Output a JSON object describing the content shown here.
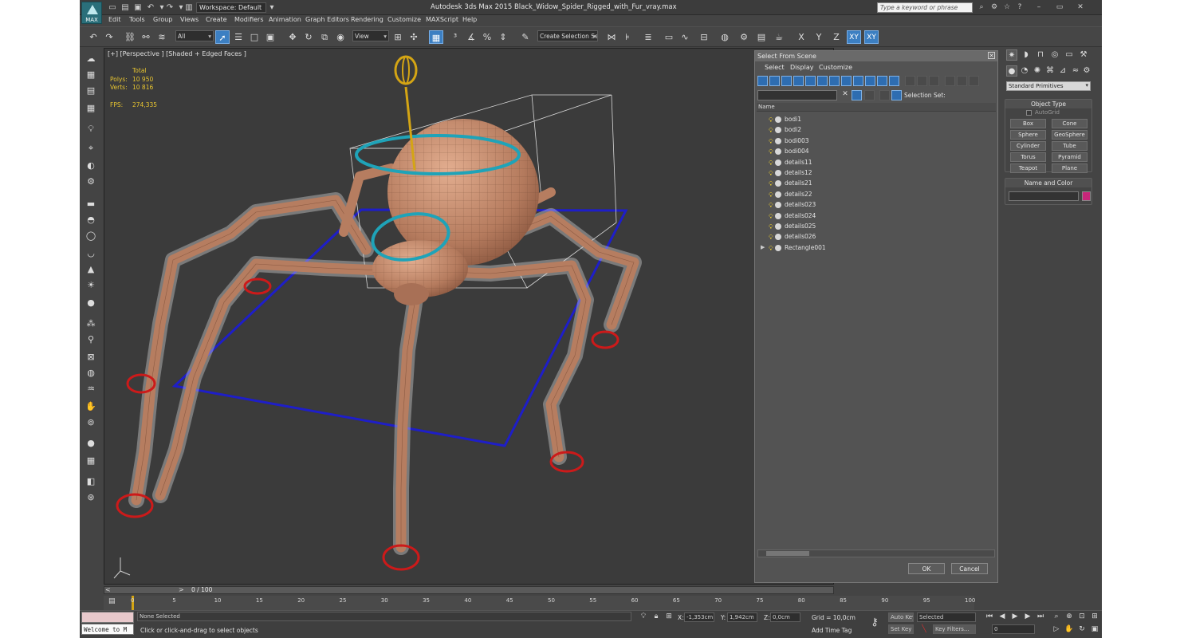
{
  "app": {
    "logo_label": "MAX",
    "workspace": "Workspace: Default",
    "title": "Autodesk 3ds Max  2015    Black_Widow_Spider_Rigged_with_Fur_vray.max",
    "search_placeholder": "Type a keyword or phrase"
  },
  "menu": [
    "Edit",
    "Tools",
    "Group",
    "Views",
    "Create",
    "Modifiers",
    "Animation",
    "Graph Editors",
    "Rendering",
    "Customize",
    "MAXScript",
    "Help"
  ],
  "toolbar": {
    "filter": "All",
    "ref_coord": "View",
    "selection_set": "Create Selection Se",
    "axes": [
      "X",
      "Y",
      "Z",
      "XY",
      "XY"
    ]
  },
  "viewport": {
    "label": "[+] [Perspective ] [Shaded + Edged Faces ]",
    "stats": {
      "total_label": "Total",
      "polys_label": "Polys:",
      "polys": "10 950",
      "verts_label": "Verts:",
      "verts": "10 816",
      "fps_label": "FPS:",
      "fps": "274,335"
    }
  },
  "scene_explorer": {
    "title": "Select From Scene",
    "menu": [
      "Select",
      "Display",
      "Customize"
    ],
    "selection_set_label": "Selection Set:",
    "column": "Name",
    "rows": [
      "bodi1",
      "bodi2",
      "bodi003",
      "bodi004",
      "details11",
      "details12",
      "details21",
      "details22",
      "details023",
      "details024",
      "details025",
      "details026",
      "Rectangle001"
    ],
    "ok": "OK",
    "cancel": "Cancel"
  },
  "command_panel": {
    "category": "Standard Primitives",
    "object_type_title": "Object Type",
    "autogrid": "AutoGrid",
    "primitives": [
      "Box",
      "Cone",
      "Sphere",
      "GeoSphere",
      "Cylinder",
      "Tube",
      "Torus",
      "Pyramid",
      "Teapot",
      "Plane"
    ],
    "name_color_title": "Name and Color",
    "color": "#c8267a"
  },
  "timeline": {
    "frame": "0 / 100",
    "ticks": [
      "0",
      "5",
      "10",
      "15",
      "20",
      "25",
      "30",
      "35",
      "40",
      "45",
      "50",
      "55",
      "60",
      "65",
      "70",
      "75",
      "80",
      "85",
      "90",
      "95",
      "100"
    ]
  },
  "status": {
    "selection": "None Selected",
    "prompt": "Click or click-and-drag to select objects",
    "maxscript": "Welcome to M",
    "x_label": "X:",
    "x": "-1,353cm",
    "y_label": "Y:",
    "y": "1,942cm",
    "z_label": "Z:",
    "z": "0,0cm",
    "grid": "Grid = 10,0cm",
    "add_time_tag": "Add Time Tag",
    "auto_key": "Auto Key",
    "set_key": "Set Key",
    "key_mode": "Selected",
    "key_filters": "Key Filters...",
    "frame_field": "0"
  }
}
